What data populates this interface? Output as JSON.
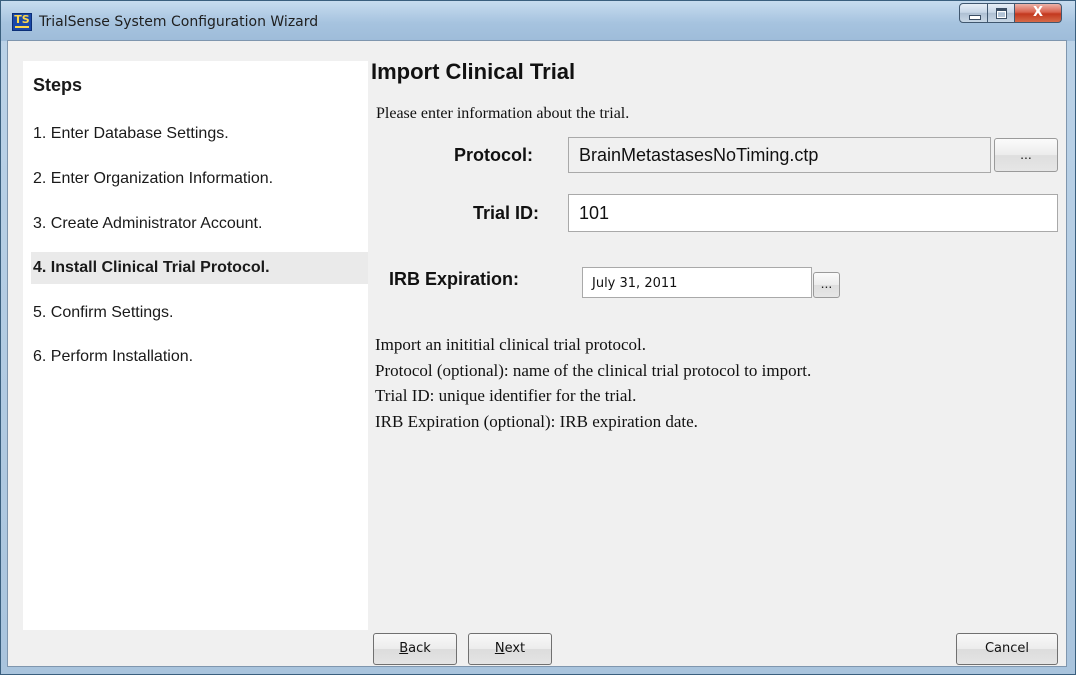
{
  "window": {
    "app_icon_text": "TS",
    "title": "TrialSense System Configuration Wizard",
    "close_glyph": "X"
  },
  "sidebar": {
    "heading": "Steps",
    "steps": [
      "1. Enter Database Settings.",
      "2. Enter Organization Information.",
      "3. Create Administrator Account.",
      "4. Install Clinical Trial Protocol.",
      "5. Confirm Settings.",
      "6. Perform Installation."
    ],
    "active_index": 3
  },
  "main": {
    "title": "Import Clinical Trial",
    "intro": "Please enter information about the trial.",
    "protocol": {
      "label": "Protocol:",
      "value": "BrainMetastasesNoTiming.ctp",
      "browse_label": "..."
    },
    "trial_id": {
      "label": "Trial ID:",
      "value": "101"
    },
    "irb_expiration": {
      "label": "IRB Expiration:",
      "value": "July 31, 2011",
      "picker_label": "..."
    },
    "help_lines": [
      "Import an inititial clinical trial protocol.",
      "Protocol (optional): name of the clinical trial protocol to import.",
      "Trial ID: unique identifier for the trial.",
      "IRB Expiration (optional): IRB expiration date."
    ]
  },
  "buttons": {
    "back": {
      "mnemonic": "B",
      "rest": "ack"
    },
    "next": {
      "mnemonic": "N",
      "rest": "ext"
    },
    "cancel": "Cancel"
  }
}
